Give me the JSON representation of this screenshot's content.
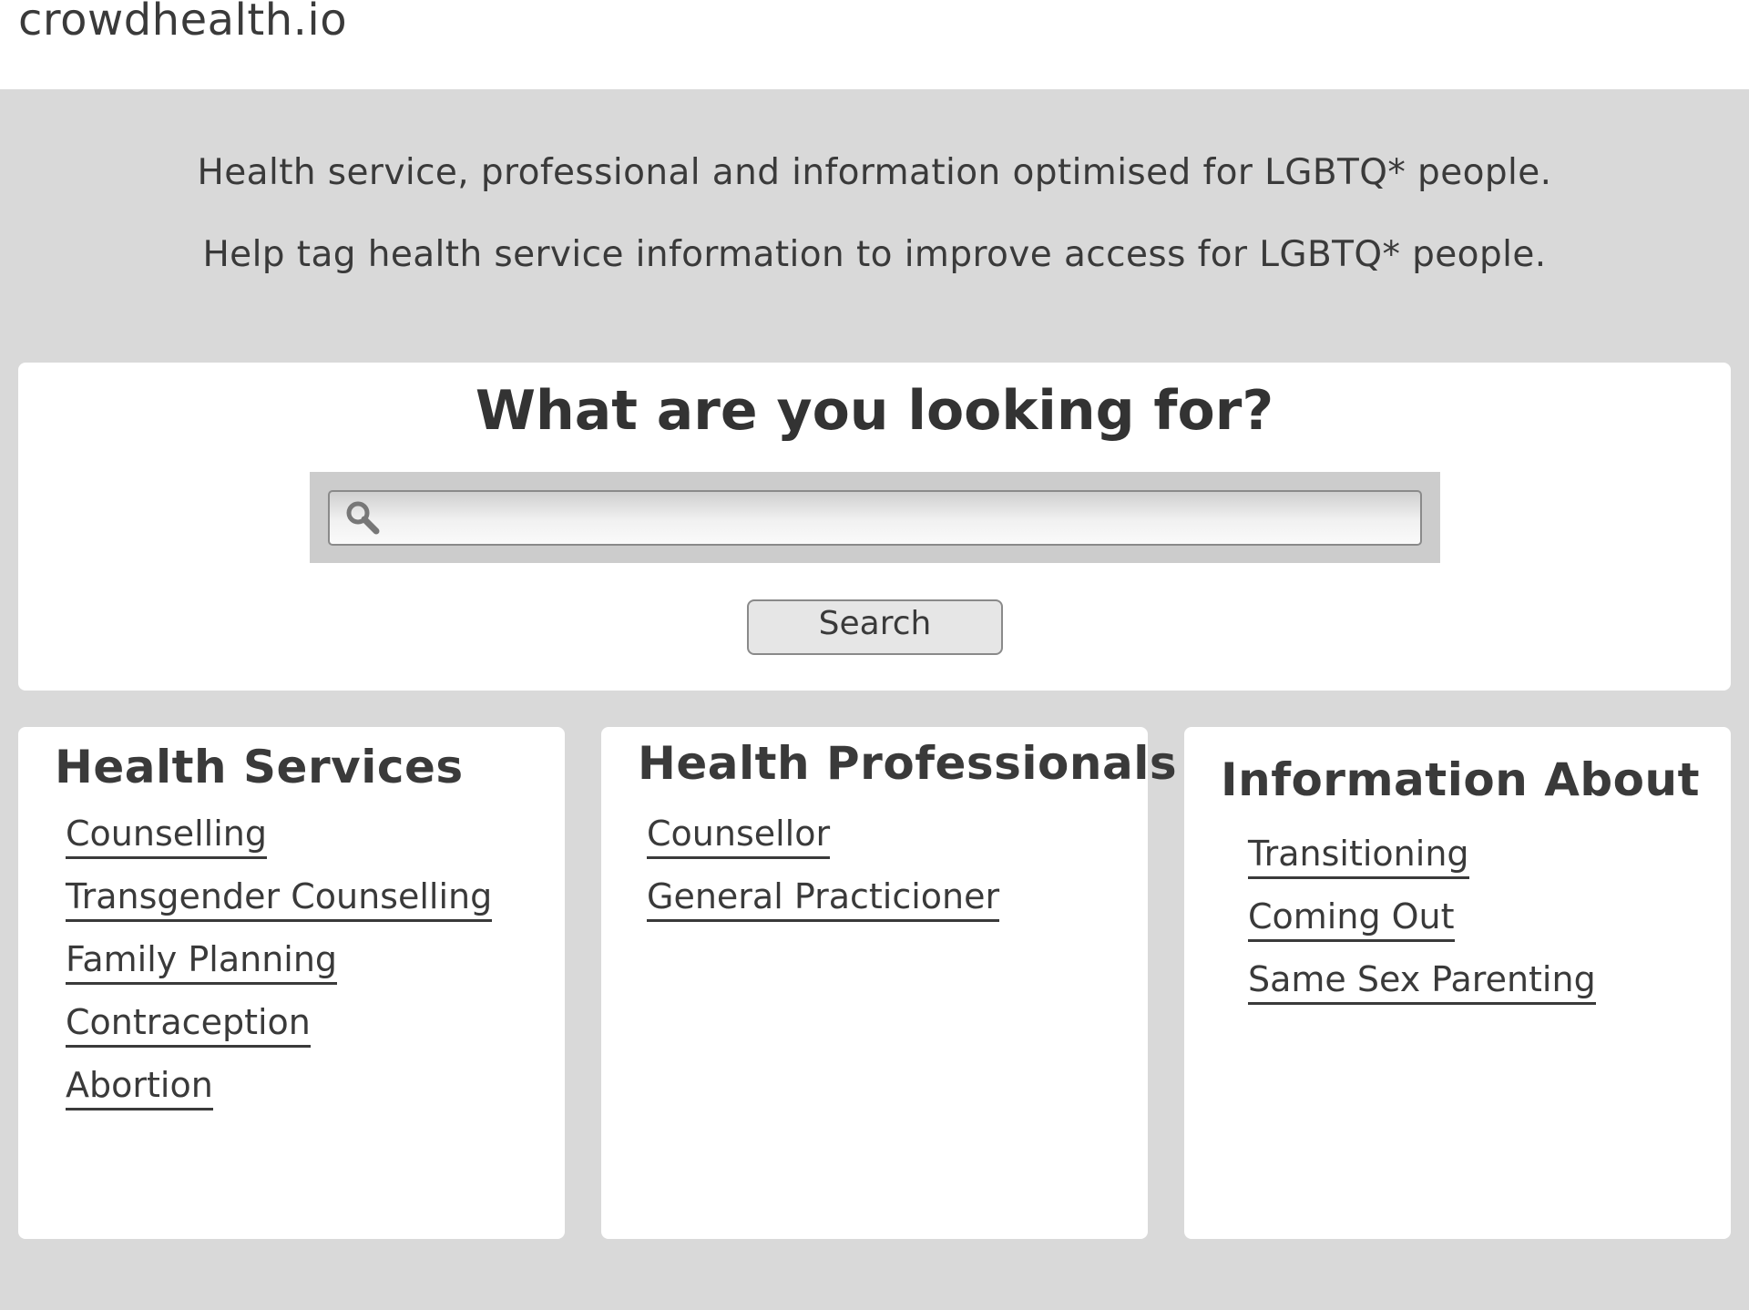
{
  "header": {
    "logo": "crowdhealth.io"
  },
  "intro": {
    "line1": "Health service, professional and information optimised for LGBTQ* people.",
    "line2": "Help tag health service information to improve access for LGBTQ* people."
  },
  "search": {
    "title": "What are you looking for?",
    "input_value": "",
    "placeholder": "",
    "button_label": "Search",
    "icon": "search-icon"
  },
  "categories": {
    "services": {
      "title": "Health Services",
      "items": [
        "Counselling",
        "Transgender Counselling",
        "Family Planning",
        "Contraception",
        "Abortion"
      ]
    },
    "professionals": {
      "title": "Health Professionals",
      "items": [
        "Counsellor",
        "General Practicioner"
      ]
    },
    "information": {
      "title": "Information About",
      "items": [
        "Transitioning",
        "Coming Out",
        "Same Sex Parenting"
      ]
    }
  },
  "colors": {
    "page_background": "#d9d9d9",
    "panel_background": "#ffffff",
    "text": "#3a3a3a",
    "input_well": "#cccccc"
  }
}
